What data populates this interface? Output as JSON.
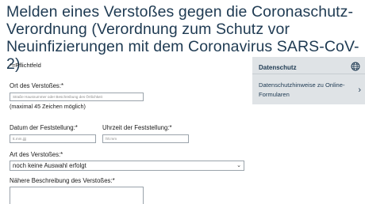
{
  "page": {
    "title": "Melden eines Verstoßes gegen die Coronaschutz-Verordnung (Verordnung zum Schutz vor Neuinfizierungen mit dem Coronavirus SARS-CoV-2)",
    "required_note": "*=Pflichtfeld"
  },
  "form": {
    "location": {
      "label": "Ort des Verstoßes:*",
      "placeholder": "Straße Hausnummer oder Beschreibung des Örtlichkeit",
      "hint": "(maximal 45 Zeichen möglich)"
    },
    "date": {
      "label": "Datum der Feststellung:*",
      "placeholder": "tt.mm.jjjj"
    },
    "time": {
      "label": "Uhrzeit der Feststellung:*",
      "placeholder": "hh:mm"
    },
    "type": {
      "label": "Art des Verstoßes:*",
      "selected": "noch keine Auswahl erfolgt"
    },
    "description": {
      "label": "Nähere Beschreibung des Verstoßes:*"
    }
  },
  "sidebar": {
    "title": "Datenschutz",
    "link": "Datenschutzhinweise zu Online-Formularen",
    "icon": "globe-icon",
    "arrow_icon": "chevron-right-icon"
  }
}
